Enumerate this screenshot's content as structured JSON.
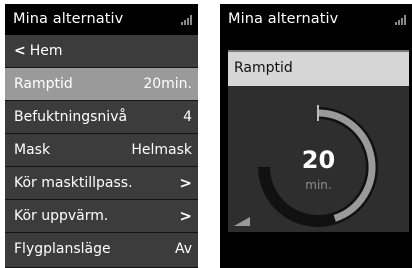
{
  "menu_screen": {
    "title": "Mina alternativ",
    "back_label": "Hem",
    "items": [
      {
        "label": "Ramptid",
        "value": "20min."
      },
      {
        "label": "Befuktningsnivå",
        "value": "4"
      },
      {
        "label": "Mask",
        "value": "Helmask"
      },
      {
        "label": "Kör masktillpass.",
        "value": ">"
      },
      {
        "label": "Kör uppvärm.",
        "value": ">"
      },
      {
        "label": "Flygplansläge",
        "value": "Av"
      }
    ]
  },
  "detail_screen": {
    "title": "Mina alternativ",
    "panel_title": "Ramptid",
    "value": "20",
    "unit": "min.",
    "gauge_fraction": 0.45
  },
  "colors": {
    "selected_row": "#9a9a9a",
    "row": "#3c3c3c",
    "panel": "#2e2e2e",
    "panel_header": "#d6d6d6",
    "gauge_track": "#111111",
    "gauge_fill": "#9a9a9a"
  },
  "icons": {
    "signal": "signal-bars-icon",
    "back": "chevron-left-icon",
    "next": "chevron-right-icon",
    "corner": "ramp-triangle-icon"
  }
}
